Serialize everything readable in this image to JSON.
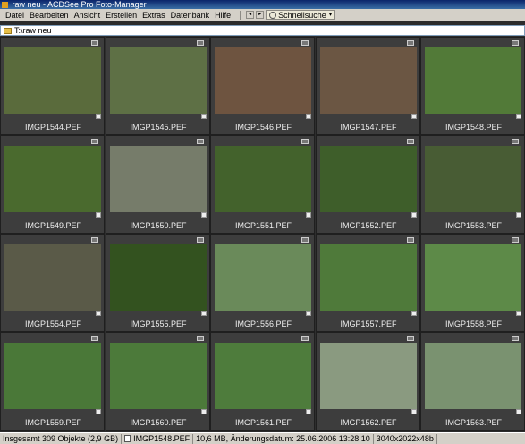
{
  "window": {
    "title": "raw neu - ACDSee Pro Foto-Manager"
  },
  "menubar": {
    "items": [
      "Datei",
      "Bearbeiten",
      "Ansicht",
      "Erstellen",
      "Extras",
      "Datenbank",
      "Hilfe"
    ],
    "search_label": "Schnellsuche"
  },
  "path": {
    "value": "T:\\raw neu"
  },
  "thumbnails": [
    {
      "name": "IMGP1544.PEF",
      "bg": "#5a6b3c"
    },
    {
      "name": "IMGP1545.PEF",
      "bg": "#5e7045"
    },
    {
      "name": "IMGP1546.PEF",
      "bg": "#6e5440"
    },
    {
      "name": "IMGP1547.PEF",
      "bg": "#6b5643"
    },
    {
      "name": "IMGP1548.PEF",
      "bg": "#527a38"
    },
    {
      "name": "IMGP1549.PEF",
      "bg": "#4a6a2e"
    },
    {
      "name": "IMGP1550.PEF",
      "bg": "#767c6a"
    },
    {
      "name": "IMGP1551.PEF",
      "bg": "#43622c"
    },
    {
      "name": "IMGP1552.PEF",
      "bg": "#3e5e2a"
    },
    {
      "name": "IMGP1553.PEF",
      "bg": "#485c34"
    },
    {
      "name": "IMGP1554.PEF",
      "bg": "#5a5a48"
    },
    {
      "name": "IMGP1555.PEF",
      "bg": "#33521f"
    },
    {
      "name": "IMGP1556.PEF",
      "bg": "#6a8a5a"
    },
    {
      "name": "IMGP1557.PEF",
      "bg": "#4f7a3a"
    },
    {
      "name": "IMGP1558.PEF",
      "bg": "#5d8a48"
    },
    {
      "name": "IMGP1559.PEF",
      "bg": "#4a7838"
    },
    {
      "name": "IMGP1560.PEF",
      "bg": "#4c7a3a"
    },
    {
      "name": "IMGP1561.PEF",
      "bg": "#4e7c3c"
    },
    {
      "name": "IMGP1562.PEF",
      "bg": "#8a9a80"
    },
    {
      "name": "IMGP1563.PEF",
      "bg": "#7a9270"
    }
  ],
  "status": {
    "total": "Insgesamt 309 Objekte  (2,9 GB)",
    "selected_file": "IMGP1548.PEF",
    "file_info": "10,6 MB, Änderungsdatum: 25.06.2006 13:28:10",
    "dimensions": "3040x2022x48b"
  }
}
